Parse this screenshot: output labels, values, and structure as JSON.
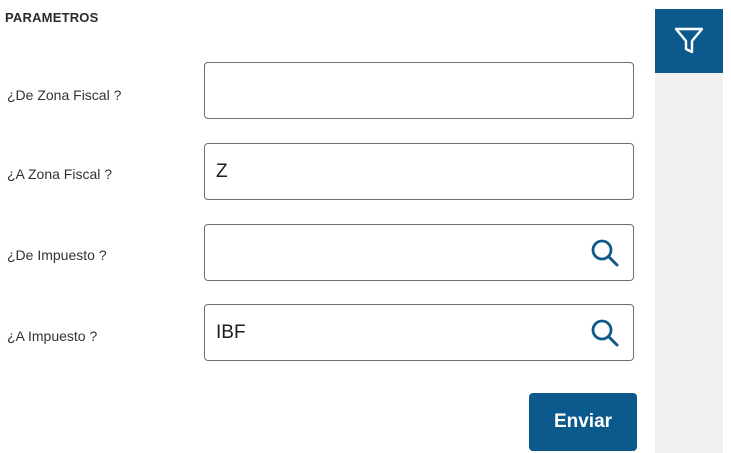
{
  "section": {
    "title": "PARAMETROS"
  },
  "fields": [
    {
      "label": "¿De Zona Fiscal ?",
      "value": "",
      "has_search": false
    },
    {
      "label": "¿A Zona Fiscal ?",
      "value": "Z",
      "has_search": false
    },
    {
      "label": "¿De Impuesto ?",
      "value": "",
      "has_search": true,
      "icon": "search-icon"
    },
    {
      "label": "¿A Impuesto ?",
      "value": "IBF",
      "has_search": true,
      "icon": "search-icon"
    }
  ],
  "actions": {
    "send_label": "Enviar"
  },
  "sidebar": {
    "filter_icon": "filter-icon"
  },
  "colors": {
    "primary": "#0c5a8c",
    "panel": "#f0f0f0",
    "border": "#6f6f6f",
    "text": "#333333"
  }
}
